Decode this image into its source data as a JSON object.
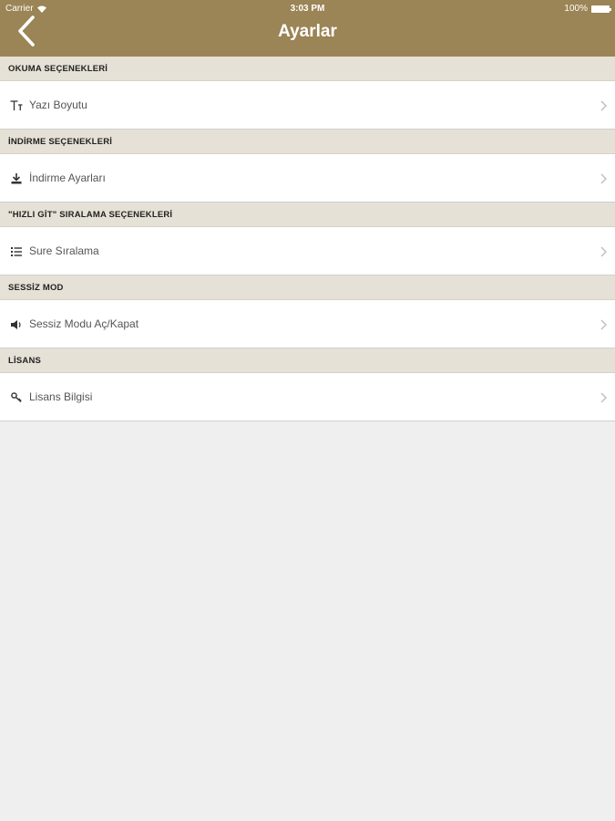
{
  "status_bar": {
    "carrier": "Carrier",
    "time": "3:03 PM",
    "battery": "100%"
  },
  "nav": {
    "title": "Ayarlar"
  },
  "sections": [
    {
      "header": "OKUMA SEÇENEKLERİ",
      "item": {
        "label": "Yazı Boyutu",
        "icon": "text-size-icon"
      }
    },
    {
      "header": "İNDİRME SEÇENEKLERİ",
      "item": {
        "label": "İndirme Ayarları",
        "icon": "download-icon"
      }
    },
    {
      "header": "\"HIZLI GİT\" SIRALAMA SEÇENEKLERİ",
      "item": {
        "label": "Sure Sıralama",
        "icon": "list-icon"
      }
    },
    {
      "header": "SESSİZ MOD",
      "item": {
        "label": "Sessiz Modu Aç/Kapat",
        "icon": "speaker-icon"
      }
    },
    {
      "header": "LİSANS",
      "item": {
        "label": "Lisans Bilgisi",
        "icon": "key-icon"
      }
    }
  ],
  "colors": {
    "nav_background": "#9b8455",
    "section_background": "#e6e1d6",
    "page_background": "#efefef"
  }
}
